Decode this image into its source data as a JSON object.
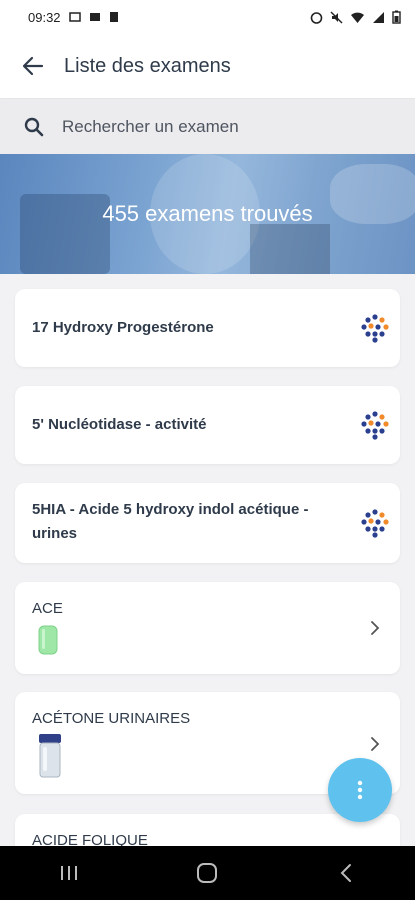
{
  "status_bar": {
    "time": "09:32",
    "battery_icon": "battery-icon"
  },
  "header": {
    "title": "Liste des examens"
  },
  "search": {
    "placeholder": "Rechercher un examen"
  },
  "banner": {
    "text": "455 examens trouvés"
  },
  "exams": [
    {
      "name": "17 Hydroxy Progestérone",
      "icon": "lab-dots-icon"
    },
    {
      "name": "5' Nucléotidase - activité",
      "icon": "lab-dots-icon"
    },
    {
      "name": "5HIA - Acide 5 hydroxy indol acétique - urines",
      "icon": "lab-dots-icon"
    },
    {
      "name": "ACE",
      "icon": "chevron-right-icon",
      "tube": "green-tube-icon"
    },
    {
      "name": "ACÉTONE URINAIRES",
      "icon": "chevron-right-icon",
      "tube": "urine-container-icon"
    },
    {
      "name": "ACIDE FOLIQUE"
    }
  ],
  "colors": {
    "accent": "#5fc2ee",
    "title": "#2f3b4a",
    "dot_blue": "#2b3f8f",
    "dot_orange": "#f08a2a"
  }
}
